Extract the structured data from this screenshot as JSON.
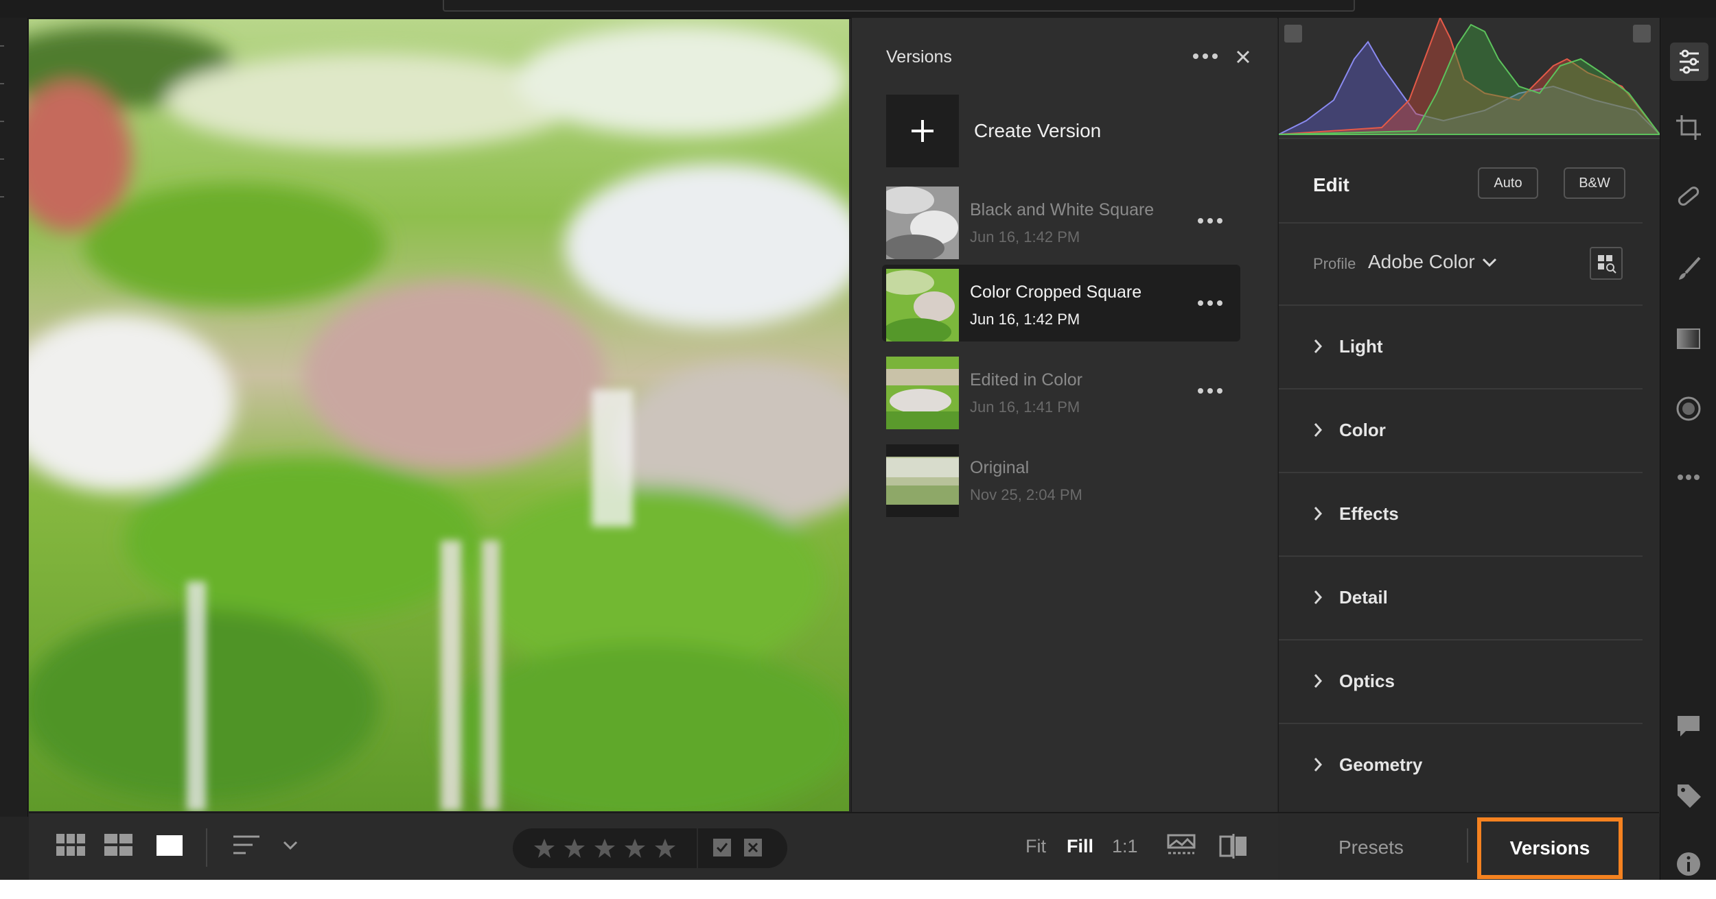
{
  "versions_panel": {
    "title": "Versions",
    "create_label": "Create Version",
    "items": [
      {
        "name": "Black and White Square",
        "date": "Jun 16, 1:42 PM",
        "selected": false,
        "thumb": "bw"
      },
      {
        "name": "Color Cropped Square",
        "date": "Jun 16, 1:42 PM",
        "selected": true,
        "thumb": "color"
      },
      {
        "name": "Edited in Color",
        "date": "Jun 16, 1:41 PM",
        "selected": false,
        "thumb": "color"
      },
      {
        "name": "Original",
        "date": "Nov 25, 2:04 PM",
        "selected": false,
        "thumb": "original"
      }
    ]
  },
  "edit_panel": {
    "title": "Edit",
    "auto_label": "Auto",
    "bw_label": "B&W",
    "profile_label": "Profile",
    "profile_value": "Adobe Color",
    "sections": [
      "Light",
      "Color",
      "Effects",
      "Detail",
      "Optics",
      "Geometry"
    ]
  },
  "bottom_bar": {
    "zoom_fit": "Fit",
    "zoom_fill": "Fill",
    "zoom_1to1": "1:1",
    "rating_stars": 0,
    "star_glyph": "★"
  },
  "bottom_tabs": {
    "presets": "Presets",
    "versions": "Versions"
  },
  "colors": {
    "highlight_border": "#f58220",
    "panel_bg": "#2e2e2e",
    "histogram_blue": "#6a6ad8",
    "histogram_red": "#d8483a",
    "histogram_green": "#4aa84a"
  },
  "icons": {
    "right_toolbar": [
      "sliders-icon",
      "crop-icon",
      "heal-icon",
      "brush-icon",
      "linear-gradient-icon",
      "radial-gradient-icon",
      "more-icon",
      "comment-icon",
      "tag-icon",
      "info-icon"
    ]
  }
}
